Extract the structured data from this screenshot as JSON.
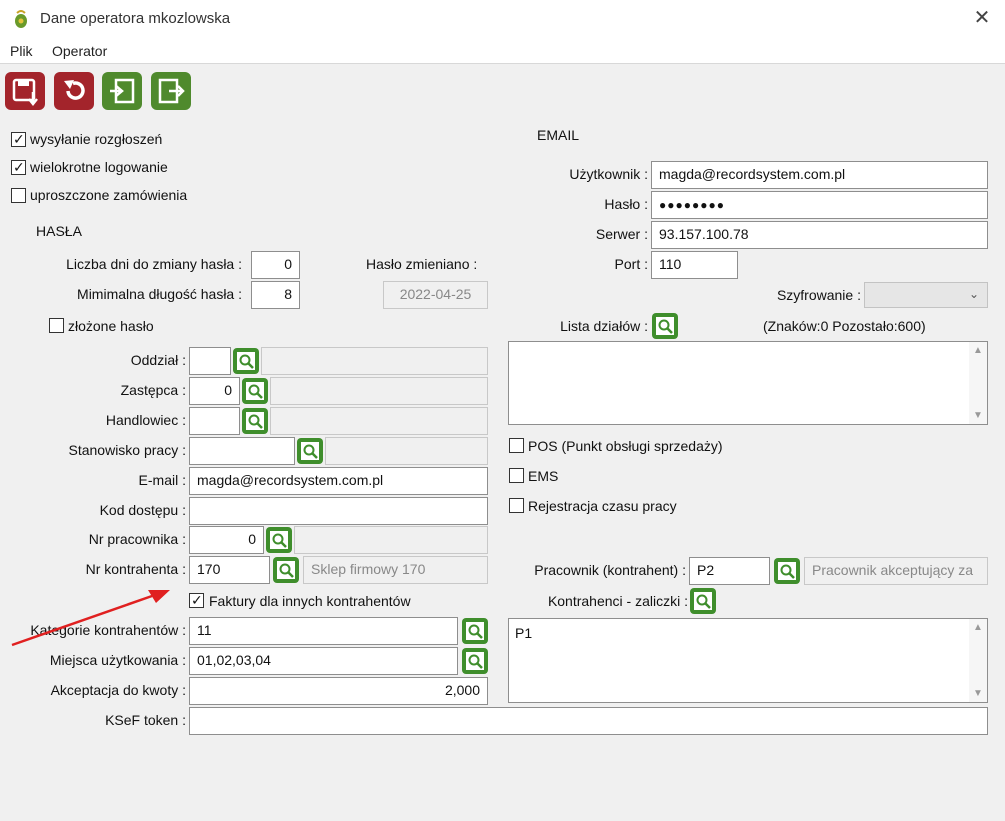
{
  "window": {
    "title": "Dane operatora mkozlowska",
    "close_glyph": "✕"
  },
  "menu": {
    "items": [
      "Plik",
      "Operator"
    ]
  },
  "toolbar": {
    "buttons": [
      "save-icon",
      "undo-icon",
      "login-icon",
      "logout-icon"
    ]
  },
  "options": {
    "sending_announcements": {
      "label": "wysyłanie rozgłoszeń",
      "checked": true
    },
    "multiple_login": {
      "label": "wielokrotne logowanie",
      "checked": true
    },
    "simplified_orders": {
      "label": "uproszczone zamówienia",
      "checked": false
    }
  },
  "passwords": {
    "section_title": "HASŁA",
    "days_to_change_label": "Liczba dni do zmiany hasła :",
    "days_to_change_value": "0",
    "min_length_label": "Mimimalna długość hasła :",
    "min_length_value": "8",
    "changed_label": "Hasło zmieniano :",
    "changed_value": "2022-04-25",
    "complex_label": "złożone hasło",
    "complex_checked": false
  },
  "fields": {
    "branch_label": "Oddział :",
    "branch_value": "",
    "substitute_label": "Zastępca :",
    "substitute_value": "0",
    "salesman_label": "Handlowiec :",
    "salesman_value": "",
    "workstation_label": "Stanowisko pracy :",
    "workstation_value": "",
    "email_label": "E-mail :",
    "email_value": "magda@recordsystem.com.pl",
    "access_code_label": "Kod dostępu :",
    "access_code_value": "",
    "employee_no_label": "Nr pracownika :",
    "employee_no_value": "0",
    "contractor_no_label": "Nr kontrahenta :",
    "contractor_no_value": "170",
    "contractor_name": "Sklep firmowy 170",
    "invoices_label": "Faktury dla innych kontrahentów",
    "invoices_checked": true,
    "categories_label": "Kategorie kontrahentów :",
    "categories_value": "11",
    "places_label": "Miejsca użytkowania :",
    "places_value": "01,02,03,04",
    "accept_amount_label": "Akceptacja do kwoty :",
    "accept_amount_value": "2,000",
    "ksef_label": "KSeF token :",
    "ksef_value": ""
  },
  "email": {
    "section_title": "EMAIL",
    "user_label": "Użytkownik :",
    "user_value": "magda@recordsystem.com.pl",
    "password_label": "Hasło :",
    "password_value": "●●●●●●●●",
    "server_label": "Serwer :",
    "server_value": "93.157.100.78",
    "port_label": "Port :",
    "port_value": "110",
    "encryption_label": "Szyfrowanie :",
    "encryption_value": "",
    "departments_label": "Lista działów :",
    "departments_counter": "(Znaków:0  Pozostało:600)",
    "departments_value": ""
  },
  "right_options": {
    "pos": {
      "label": "POS (Punkt obsługi sprzedaży)",
      "checked": false
    },
    "ems": {
      "label": "EMS",
      "checked": false
    },
    "time_reg": {
      "label": "Rejestracja czasu pracy",
      "checked": false
    }
  },
  "employee": {
    "label": "Pracownik (kontrahent) :",
    "value": "P2",
    "accepting_placeholder": "Pracownik akceptujący za",
    "advances_label": "Kontrahenci - zaliczki :",
    "advances_value": "P1"
  },
  "colors": {
    "red_button": "#a3242b",
    "green_button": "#4f8a2d",
    "lookup": "#3f8e2c",
    "annotation_arrow": "#e02020"
  }
}
